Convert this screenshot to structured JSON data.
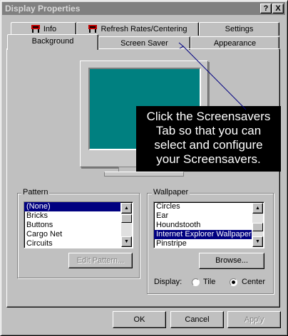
{
  "window": {
    "title": "Display Properties",
    "help_glyph": "?",
    "close_glyph": "X"
  },
  "tabs_back": [
    {
      "label": "Info",
      "icon": "info-flag-icon"
    },
    {
      "label": "Refresh Rates/Centering",
      "icon": "refresh-flag-icon"
    },
    {
      "label": "Settings"
    }
  ],
  "tabs_front": [
    {
      "label": "Background",
      "active": true
    },
    {
      "label": "Screen Saver"
    },
    {
      "label": "Appearance"
    }
  ],
  "callout": {
    "lines": [
      "Click the Screensavers",
      "Tab so that you can",
      "select and configure",
      "your Screensavers."
    ]
  },
  "pattern": {
    "label": "Pattern",
    "items": [
      "(None)",
      "Bricks",
      "Buttons",
      "Cargo Net",
      "Circuits"
    ],
    "selected_index": 0,
    "edit_button": "Edit Pattern..."
  },
  "wallpaper": {
    "label": "Wallpaper",
    "items": [
      "Circles",
      "Ear",
      "Houndstooth",
      "Internet Explorer Wallpaper",
      "Pinstripe"
    ],
    "selected_index": 3,
    "browse_button": "Browse...",
    "display_label": "Display:",
    "options": [
      "Tile",
      "Center"
    ],
    "selected_option": "Center"
  },
  "buttons": {
    "ok": "OK",
    "cancel": "Cancel",
    "apply": "Apply"
  },
  "colors": {
    "selection": "#000080",
    "desktop": "#008080",
    "face": "#c0c0c0"
  }
}
